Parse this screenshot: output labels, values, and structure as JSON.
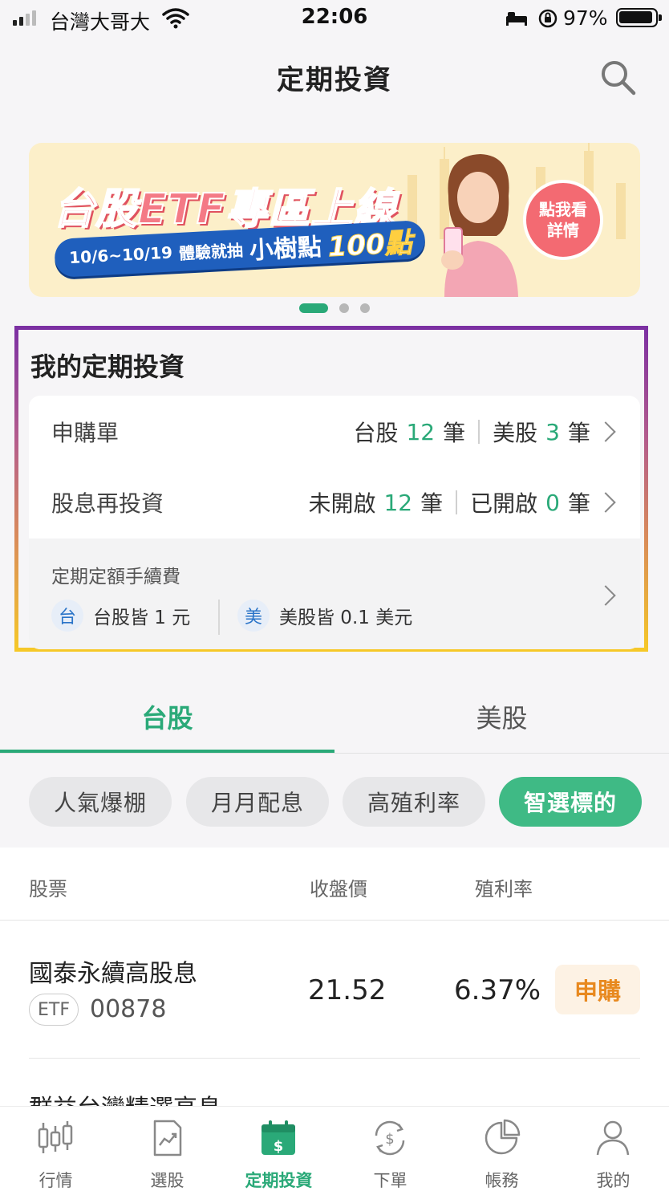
{
  "status_bar": {
    "carrier": "台灣大哥大",
    "time": "22:06",
    "battery": "97%"
  },
  "header": {
    "title": "定期投資",
    "search_icon": "search-icon"
  },
  "banner": {
    "title": "台股ETF專區上線",
    "pill_dates": "10/6~10/19",
    "pill_text": "體驗就抽",
    "pill_big": "小樹點",
    "pill_num": "100點",
    "cta_line1": "點我看",
    "cta_line2": "詳情",
    "page_count": 3,
    "active_page": 1
  },
  "my_investment": {
    "title": "我的定期投資",
    "purchase": {
      "label": "申購單",
      "tw_label": "台股",
      "tw_count": "12",
      "us_label": "美股",
      "us_count": "3",
      "unit": "筆"
    },
    "dividend": {
      "label": "股息再投資",
      "off_label": "未開啟",
      "off_count": "12",
      "on_label": "已開啟",
      "on_count": "0",
      "unit": "筆"
    },
    "fee": {
      "title": "定期定額手續費",
      "tw_badge": "台",
      "tw_text": "台股皆 1 元",
      "us_badge": "美",
      "us_text": "美股皆 0.1 美元"
    }
  },
  "tabs": [
    {
      "label": "台股",
      "active": true
    },
    {
      "label": "美股",
      "active": false
    }
  ],
  "chips": [
    {
      "label": "人氣爆棚",
      "active": false
    },
    {
      "label": "月月配息",
      "active": false
    },
    {
      "label": "高殖利率",
      "active": false
    },
    {
      "label": "智選標的",
      "active": true
    }
  ],
  "table": {
    "headers": {
      "stock": "股票",
      "price": "收盤價",
      "yield": "殖利率"
    },
    "rows": [
      {
        "name": "國泰永續高股息",
        "tag": "ETF",
        "code": "00878",
        "price": "21.52",
        "yield": "6.37%",
        "action": "申購"
      },
      {
        "name": "群益台灣精選高息"
      }
    ]
  },
  "bottom_nav": [
    {
      "label": "行情",
      "icon": "candlestick-icon",
      "active": false
    },
    {
      "label": "選股",
      "icon": "chart-select-icon",
      "active": false
    },
    {
      "label": "定期投資",
      "icon": "calendar-dollar-icon",
      "active": true
    },
    {
      "label": "下單",
      "icon": "dollar-exchange-icon",
      "active": false
    },
    {
      "label": "帳務",
      "icon": "pie-chart-icon",
      "active": false
    },
    {
      "label": "我的",
      "icon": "person-icon",
      "active": false
    }
  ],
  "colors": {
    "accent": "#2aa978",
    "chip_active": "#3fba85",
    "subscribe_text": "#e8891f",
    "highlight_top": "#7b2fa3",
    "highlight_bottom": "#f6c928"
  }
}
